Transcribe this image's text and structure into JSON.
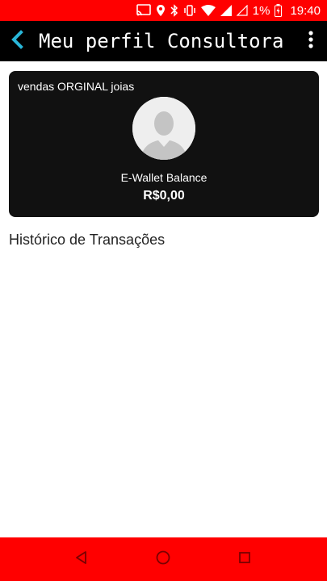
{
  "status_bar": {
    "battery": "1%",
    "time": "19:40",
    "icons": [
      "cast-icon",
      "location-icon",
      "bluetooth-icon",
      "vibrate-icon",
      "wifi-icon",
      "signal-icon",
      "signal-empty-icon",
      "battery-charging-icon"
    ],
    "color": "#ff0000"
  },
  "app_bar": {
    "title": "Meu perfil Consultora",
    "back_icon": "chevron-left-icon",
    "menu_icon": "more-vert-icon",
    "accent": "#29b6d8"
  },
  "wallet_card": {
    "store_name": "vendas ORGINAL joias",
    "avatar_icon": "person-placeholder-icon",
    "balance_label": "E-Wallet Balance",
    "balance_value": "R$0,00"
  },
  "transactions": {
    "title": "Histórico de Transações",
    "items": []
  },
  "nav_bar": {
    "buttons": [
      "back-triangle-icon",
      "home-circle-icon",
      "recents-square-icon"
    ]
  }
}
